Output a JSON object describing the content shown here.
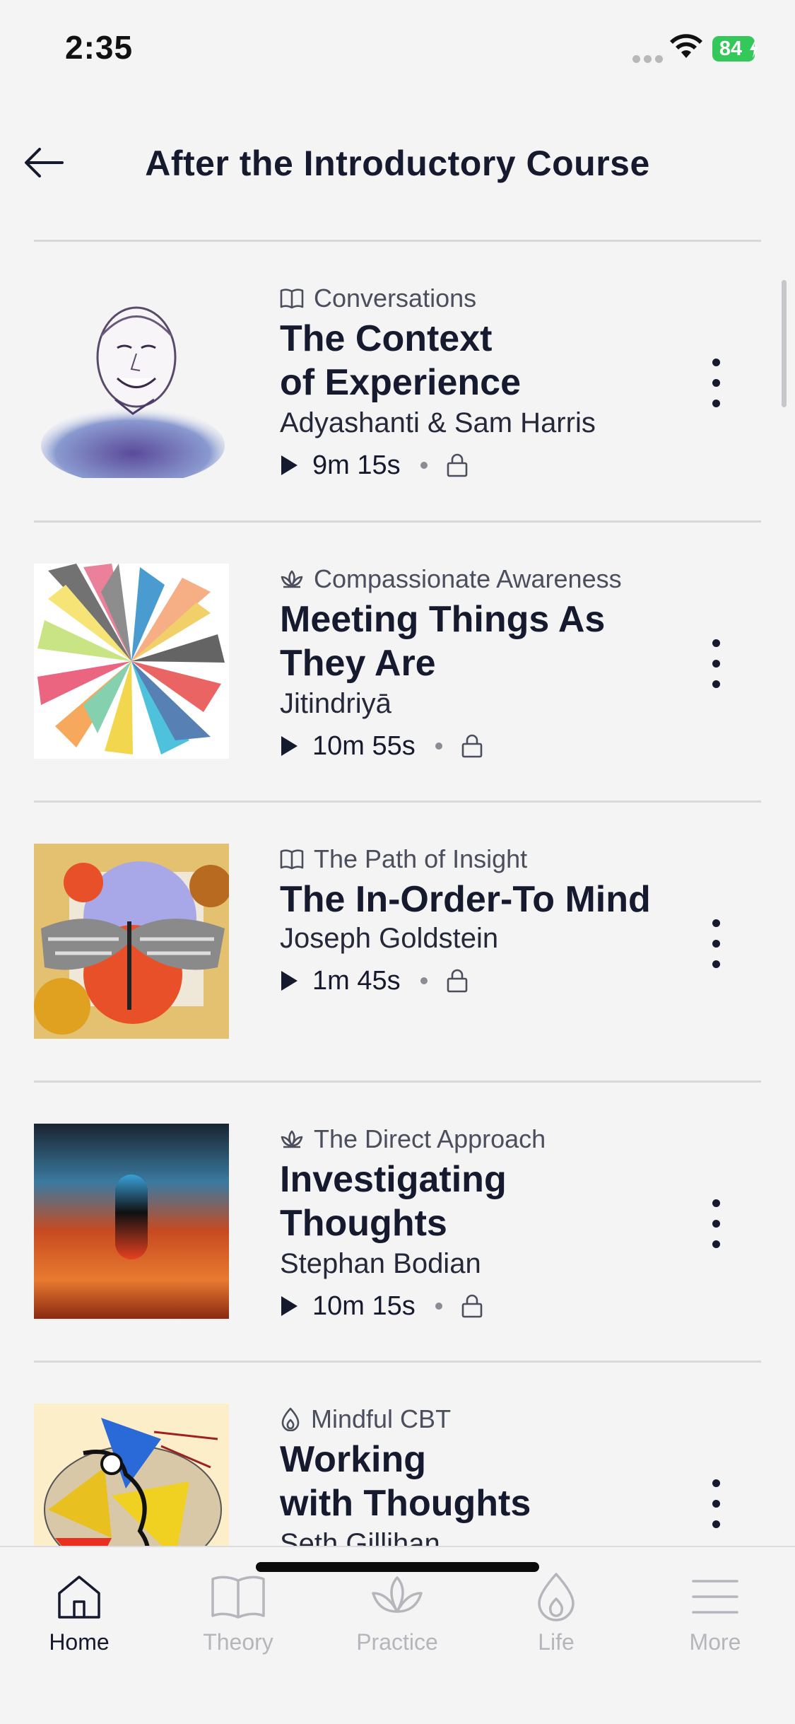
{
  "status_bar": {
    "time": "2:35",
    "battery": "84"
  },
  "header": {
    "title": "After the Introductory Course"
  },
  "courses": [
    {
      "category": "Conversations",
      "category_icon": "book-icon",
      "title": "The Context\nof Experience",
      "author": "Adyashanti & Sam Harris",
      "duration": "9m 15s"
    },
    {
      "category": "Compassionate Awareness",
      "category_icon": "lotus-icon",
      "title": "Meeting Things As\nThey Are",
      "author": "Jitindriyā",
      "duration": "10m 55s"
    },
    {
      "category": "The Path of Insight",
      "category_icon": "book-icon",
      "title": "The In-Order-To Mind",
      "author": "Joseph Goldstein",
      "duration": "1m 45s"
    },
    {
      "category": "The Direct Approach",
      "category_icon": "lotus-icon",
      "title": "Investigating\nThoughts",
      "author": "Stephan Bodian",
      "duration": "10m 15s"
    },
    {
      "category": "Mindful CBT",
      "category_icon": "flame-icon",
      "title": "Working\nwith Thoughts",
      "author": "Seth Gillihan",
      "duration": ""
    }
  ],
  "tabs": [
    {
      "label": "Home",
      "icon": "home-icon",
      "active": true
    },
    {
      "label": "Theory",
      "icon": "book-icon",
      "active": false
    },
    {
      "label": "Practice",
      "icon": "lotus-icon",
      "active": false
    },
    {
      "label": "Life",
      "icon": "flame-icon",
      "active": false
    },
    {
      "label": "More",
      "icon": "menu-icon",
      "active": false
    }
  ],
  "colors": {
    "background": "#f4f4f5",
    "text": "#161a2e",
    "battery": "#34c759",
    "inactive_tab": "#b5b6bb"
  }
}
